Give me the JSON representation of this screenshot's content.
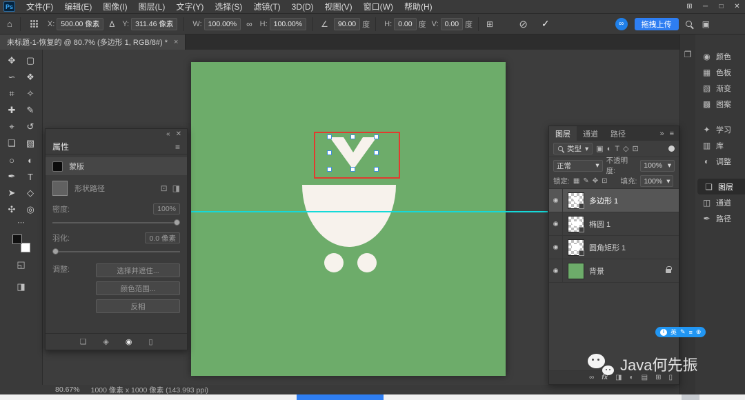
{
  "window": {
    "logo": "Ps",
    "controls": {
      "workspace": "⊞",
      "minimize": "─",
      "maximize": "□",
      "close": "✕"
    }
  },
  "menu": {
    "items": [
      "文件(F)",
      "编辑(E)",
      "图像(I)",
      "图层(L)",
      "文字(Y)",
      "选择(S)",
      "滤镜(T)",
      "3D(D)",
      "视图(V)",
      "窗口(W)",
      "帮助(H)"
    ]
  },
  "options_bar": {
    "home_icon": "⌂",
    "x_label": "X:",
    "x_value": "500.00 像素",
    "delta_icon": "Δ",
    "y_label": "Y:",
    "y_value": "311.46 像素",
    "w_label": "W:",
    "w_value": "100.00%",
    "link_icon": "∞",
    "h_label": "H:",
    "h_value": "100.00%",
    "angle_icon": "∠",
    "angle_value": "90.00",
    "angle_unit": "度",
    "skew_h_label": "H:",
    "skew_h_value": "0.00",
    "skew_h_unit": "度",
    "skew_v_label": "V:",
    "skew_v_value": "0.00",
    "skew_v_unit": "度",
    "interp_icon": "⊞",
    "cancel_icon": "⊘",
    "commit_icon": "✓",
    "cloud_icon": "∞",
    "upload_label": "拖拽上传"
  },
  "doc_tab": {
    "title": "未标题-1-恢复的 @ 80.7% (多边形 1, RGB/8#) *",
    "close": "×"
  },
  "toolbar": {
    "tools": [
      {
        "name": "move-tool",
        "glyph": "✥"
      },
      {
        "name": "marquee-tool",
        "glyph": "▢"
      },
      {
        "name": "lasso-tool",
        "glyph": "∽"
      },
      {
        "name": "quick-select-tool",
        "glyph": "❖"
      },
      {
        "name": "crop-tool",
        "glyph": "⌗"
      },
      {
        "name": "eyedropper-tool",
        "glyph": "✧"
      },
      {
        "name": "healing-tool",
        "glyph": "✚"
      },
      {
        "name": "brush-tool",
        "glyph": "✎"
      },
      {
        "name": "stamp-tool",
        "glyph": "⌖"
      },
      {
        "name": "history-brush-tool",
        "glyph": "↺"
      },
      {
        "name": "eraser-tool",
        "glyph": "❑"
      },
      {
        "name": "gradient-tool",
        "glyph": "▧"
      },
      {
        "name": "blur-tool",
        "glyph": "○"
      },
      {
        "name": "dodge-tool",
        "glyph": "◐"
      },
      {
        "name": "pen-tool",
        "glyph": "✒"
      },
      {
        "name": "type-tool",
        "glyph": "T"
      },
      {
        "name": "path-select-tool",
        "glyph": "➤"
      },
      {
        "name": "shape-tool",
        "glyph": "◇"
      },
      {
        "name": "hand-tool",
        "glyph": "✣"
      },
      {
        "name": "zoom-tool",
        "glyph": "◎"
      }
    ],
    "more_icon": "⋯",
    "extra": [
      {
        "name": "quick-mask",
        "glyph": "◱"
      },
      {
        "name": "screen-mode",
        "glyph": "◨"
      }
    ]
  },
  "properties": {
    "collapse_icon": "«",
    "close_icon": "✕",
    "title": "属性",
    "menu_icon": "≡",
    "mask_label": "蒙版",
    "shape_path_label": "形状路径",
    "op1_icon": "⊡",
    "op2_icon": "◨",
    "density_label": "密度:",
    "density_value": "100%",
    "feather_label": "羽化:",
    "feather_value": "0.0 像素",
    "adjust_label": "调整:",
    "buttons": [
      "选择并遮住...",
      "颜色范围...",
      "反相"
    ],
    "footer_icons": {
      "load": "❏",
      "apply": "◈",
      "eye": "◉",
      "delete": "▯"
    }
  },
  "layers_panel": {
    "tabs": [
      "图层",
      "通道",
      "路径"
    ],
    "collapse_icon": "»",
    "menu_icon": "≡",
    "filter_label": "类型",
    "caret": "▾",
    "filter_icons": {
      "image": "▣",
      "adjust": "◐",
      "type": "T",
      "shape": "◇",
      "smart": "⊡"
    },
    "blend_mode": "正常",
    "opacity_label": "不透明度:",
    "opacity_value": "100%",
    "lock_label": "锁定:",
    "lock_icons": {
      "transparent": "▦",
      "pixels": "✎",
      "position": "✥",
      "artboard": "⊡"
    },
    "fill_label": "填充:",
    "fill_value": "100%",
    "eye_icon": "◉",
    "rows": [
      {
        "name": "多边形 1"
      },
      {
        "name": "椭圆 1"
      },
      {
        "name": "圆角矩形 1"
      },
      {
        "name": "背景"
      }
    ],
    "footer": {
      "link": "∞",
      "fx": "fx",
      "mask": "◨",
      "adjust": "◐",
      "group": "▤",
      "new_layer": "⊞",
      "delete": "▯"
    }
  },
  "right_dock": {
    "items": [
      {
        "label": "颜色",
        "glyph": "◉"
      },
      {
        "label": "色板",
        "glyph": "▦"
      },
      {
        "label": "渐变",
        "glyph": "▧"
      },
      {
        "label": "图案",
        "glyph": "▩"
      },
      {
        "label": "学习",
        "glyph": "✦"
      },
      {
        "label": "库",
        "glyph": "▥"
      },
      {
        "label": "调整",
        "glyph": "◐"
      },
      {
        "label": "图层",
        "glyph": "❏"
      },
      {
        "label": "通道",
        "glyph": "◫"
      },
      {
        "label": "路径",
        "glyph": "✒"
      }
    ],
    "active": "图层"
  },
  "strip": {
    "icon": "❐"
  },
  "status_bar": {
    "zoom": "80.67%",
    "doc_info": "1000 像素 x 1000 像素 (143.993 ppi)"
  },
  "watermark": {
    "text": "Java何先振"
  },
  "ime_bar": {
    "brand": "i",
    "lang": "英",
    "i1": "✎",
    "i2": "≡",
    "i3": "⊕"
  },
  "colors": {
    "canvas_green": "#6dac6a",
    "shape_white": "#f7f2ec",
    "guide_cyan": "#15d9d9",
    "selection_red": "#e23b2e",
    "accent_blue": "#2e7ef2",
    "ime_blue": "#2196f3"
  }
}
